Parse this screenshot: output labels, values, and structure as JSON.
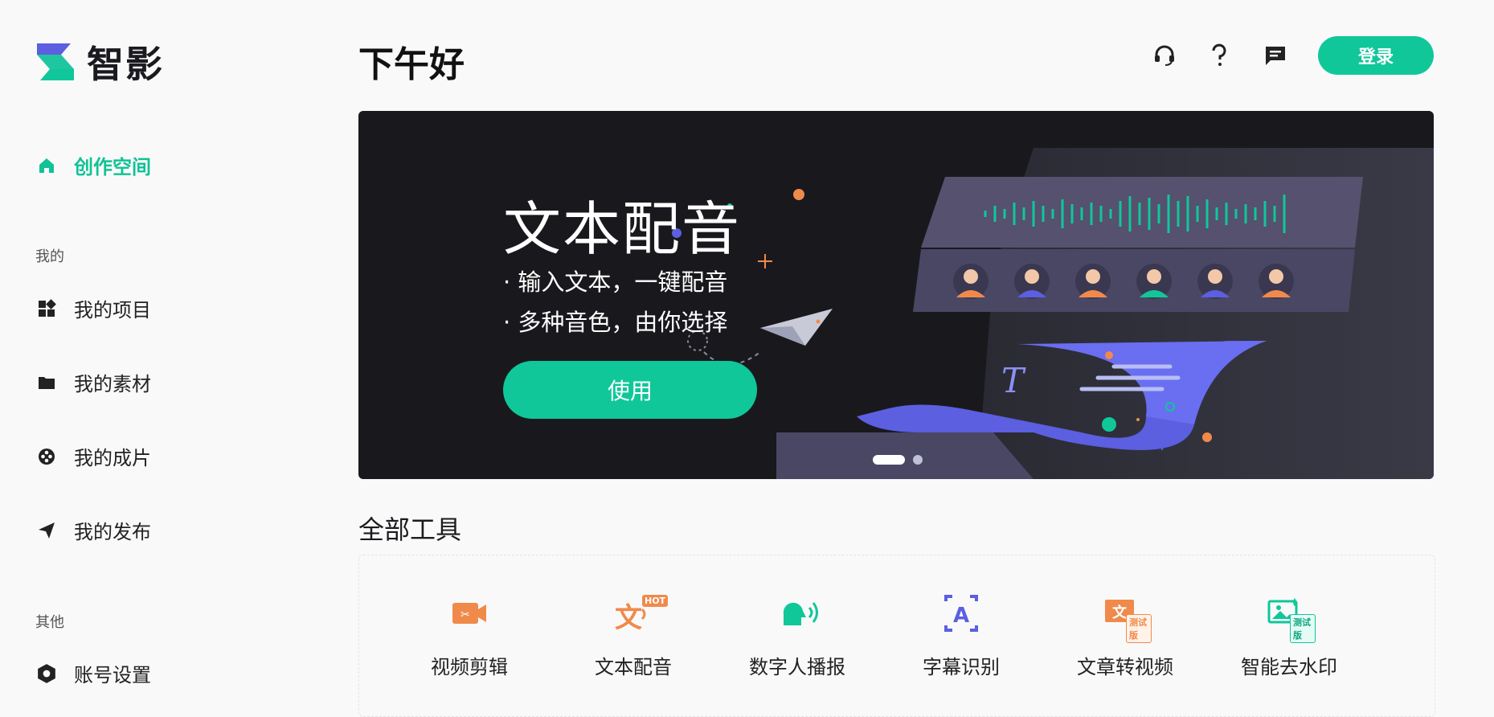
{
  "app": {
    "name": "智影",
    "brand_color": "#10c79a"
  },
  "sidebar": {
    "workspace": {
      "label": "创作空间",
      "icon": "home-icon"
    },
    "sections": [
      {
        "title": "我的",
        "items": [
          {
            "label": "我的项目",
            "icon": "grid-icon"
          },
          {
            "label": "我的素材",
            "icon": "folder-icon"
          },
          {
            "label": "我的成片",
            "icon": "film-reel-icon"
          },
          {
            "label": "我的发布",
            "icon": "send-icon"
          }
        ]
      },
      {
        "title": "其他",
        "items": [
          {
            "label": "账号设置",
            "icon": "hexagon-gear-icon"
          }
        ]
      }
    ]
  },
  "header": {
    "greeting": "下午好",
    "icons": [
      "headset-icon",
      "help-icon",
      "message-icon"
    ],
    "login_label": "登录"
  },
  "banner": {
    "title": "文本配音",
    "lines": [
      "· 输入文本，一键配音",
      "· 多种音色，由你选择"
    ],
    "button_label": "使用",
    "slide_count": 2,
    "active_slide": 1
  },
  "tools": {
    "title": "全部工具",
    "items": [
      {
        "label": "视频剪辑",
        "icon": "video-edit-icon",
        "color": "#f08a4b"
      },
      {
        "label": "文本配音",
        "icon": "text-voice-icon",
        "color": "#f08a4b",
        "badge": "HOT"
      },
      {
        "label": "数字人播报",
        "icon": "digital-human-icon",
        "color": "#10c79a"
      },
      {
        "label": "字幕识别",
        "icon": "subtitle-recognize-icon",
        "color": "#5b5fe0"
      },
      {
        "label": "文章转视频",
        "icon": "article-to-video-icon",
        "color": "#f08a4b",
        "badge": "测试版"
      },
      {
        "label": "智能去水印",
        "icon": "remove-watermark-icon",
        "color": "#10c79a",
        "badge": "测试版"
      }
    ]
  }
}
